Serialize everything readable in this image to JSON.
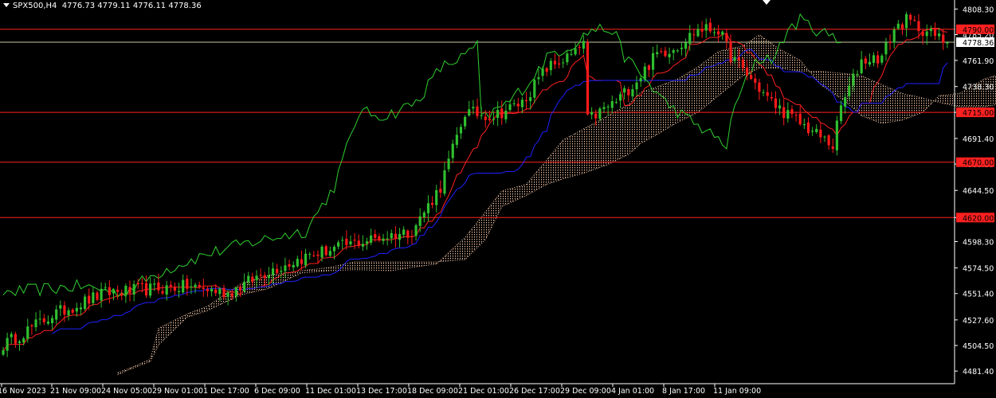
{
  "header": {
    "symbol": "SPX500,H4",
    "ohlc": "4776.73 4779.11 4776.11 4778.36"
  },
  "colors": {
    "background": "#000000",
    "axis": "#ffffff",
    "bull": "#2fbf2f",
    "bear": "#ff1a1a",
    "tenkan": "#ff2020",
    "kijun": "#2020ff",
    "chikou": "#2fd02f",
    "cloud": "#f5c8a8",
    "level": "#ff2020",
    "price_line": "#c8c8a0",
    "price_label_bg": "#ffffff",
    "level_label_bg": "#ff2020"
  },
  "chart_data": {
    "type": "candlestick",
    "ylim": [
      4470,
      4815
    ],
    "y_ticks": [
      "4808.30",
      "4785.20",
      "4761.90",
      "4738.30",
      "4715.00",
      "4691.40",
      "4668.30",
      "4644.50",
      "4620.00",
      "4598.30",
      "4574.50",
      "4551.40",
      "4527.60",
      "4504.50",
      "4481.40"
    ],
    "x_ticks": [
      "16 Nov 2023",
      "21 Nov 09:00",
      "24 Nov 05:00",
      "29 Nov 01:00",
      "1 Dec 17:00",
      "6 Dec 09:00",
      "11 Dec 01:00",
      "13 Dec 17:00",
      "18 Dec 09:00",
      "21 Dec 01:00",
      "26 Dec 17:00",
      "29 Dec 09:00",
      "4 Jan 01:00",
      "8 Jan 17:00",
      "11 Jan 09:00"
    ],
    "current_price": {
      "value": 4778.36,
      "label": "4778.36"
    },
    "levels": [
      {
        "value": 4790.0,
        "label": "4790.00"
      },
      {
        "value": 4715.0,
        "label": "4715.00"
      },
      {
        "value": 4670.0,
        "label": "4670.00"
      },
      {
        "value": 4620.0,
        "label": "4620.00"
      }
    ],
    "anchors": [
      [
        0,
        4505
      ],
      [
        12,
        4532
      ],
      [
        25,
        4552
      ],
      [
        45,
        4558
      ],
      [
        55,
        4552
      ],
      [
        65,
        4572
      ],
      [
        75,
        4586
      ],
      [
        85,
        4596
      ],
      [
        92,
        4602
      ],
      [
        100,
        4608
      ],
      [
        107,
        4648
      ],
      [
        113,
        4715
      ],
      [
        120,
        4712
      ],
      [
        127,
        4724
      ],
      [
        133,
        4755
      ],
      [
        140,
        4768
      ],
      [
        142,
        4778
      ],
      [
        143,
        4708
      ],
      [
        150,
        4725
      ],
      [
        155,
        4744
      ],
      [
        160,
        4768
      ],
      [
        165,
        4775
      ],
      [
        170,
        4790
      ],
      [
        175,
        4790
      ],
      [
        178,
        4766
      ],
      [
        183,
        4745
      ],
      [
        188,
        4724
      ],
      [
        193,
        4710
      ],
      [
        198,
        4698
      ],
      [
        203,
        4685
      ],
      [
        205,
        4720
      ],
      [
        210,
        4762
      ],
      [
        215,
        4765
      ],
      [
        218,
        4790
      ],
      [
        221,
        4798
      ],
      [
        225,
        4790
      ],
      [
        231,
        4778
      ]
    ],
    "cloud": {
      "x": [
        28,
        31,
        36,
        38,
        45,
        50,
        58,
        65,
        73,
        80,
        86,
        95,
        100,
        106,
        113,
        118,
        122,
        128,
        133,
        137,
        142,
        148,
        153,
        156,
        160,
        165,
        170,
        175,
        181,
        185,
        190,
        195,
        200,
        206,
        210,
        215,
        220,
        225,
        229,
        234,
        240,
        246,
        252,
        258,
        263
      ],
      "a": [
        4478,
        4483,
        4490,
        4505,
        4530,
        4536,
        4550,
        4556,
        4570,
        4572,
        4573,
        4572,
        4575,
        4578,
        4602,
        4625,
        4644,
        4650,
        4672,
        4690,
        4700,
        4712,
        4722,
        4733,
        4738,
        4745,
        4756,
        4770,
        4775,
        4785,
        4772,
        4762,
        4740,
        4725,
        4712,
        4705,
        4708,
        4715,
        4730,
        4732,
        4745,
        4752,
        4756,
        4762,
        4772
      ],
      "b": [
        4480,
        4484,
        4492,
        4520,
        4533,
        4540,
        4560,
        4568,
        4572,
        4575,
        4580,
        4580,
        4580,
        4580,
        4582,
        4600,
        4630,
        4640,
        4650,
        4655,
        4660,
        4668,
        4677,
        4687,
        4695,
        4706,
        4715,
        4730,
        4748,
        4755,
        4755,
        4752,
        4752,
        4750,
        4748,
        4740,
        4732,
        4728,
        4724,
        4720,
        4720,
        4724,
        4728,
        4732,
        4735
      ]
    },
    "indicators": [
      "Ichimoku Tenkan-sen",
      "Ichimoku Kijun-sen",
      "Ichimoku Chikou span",
      "Ichimoku Kumo"
    ]
  }
}
